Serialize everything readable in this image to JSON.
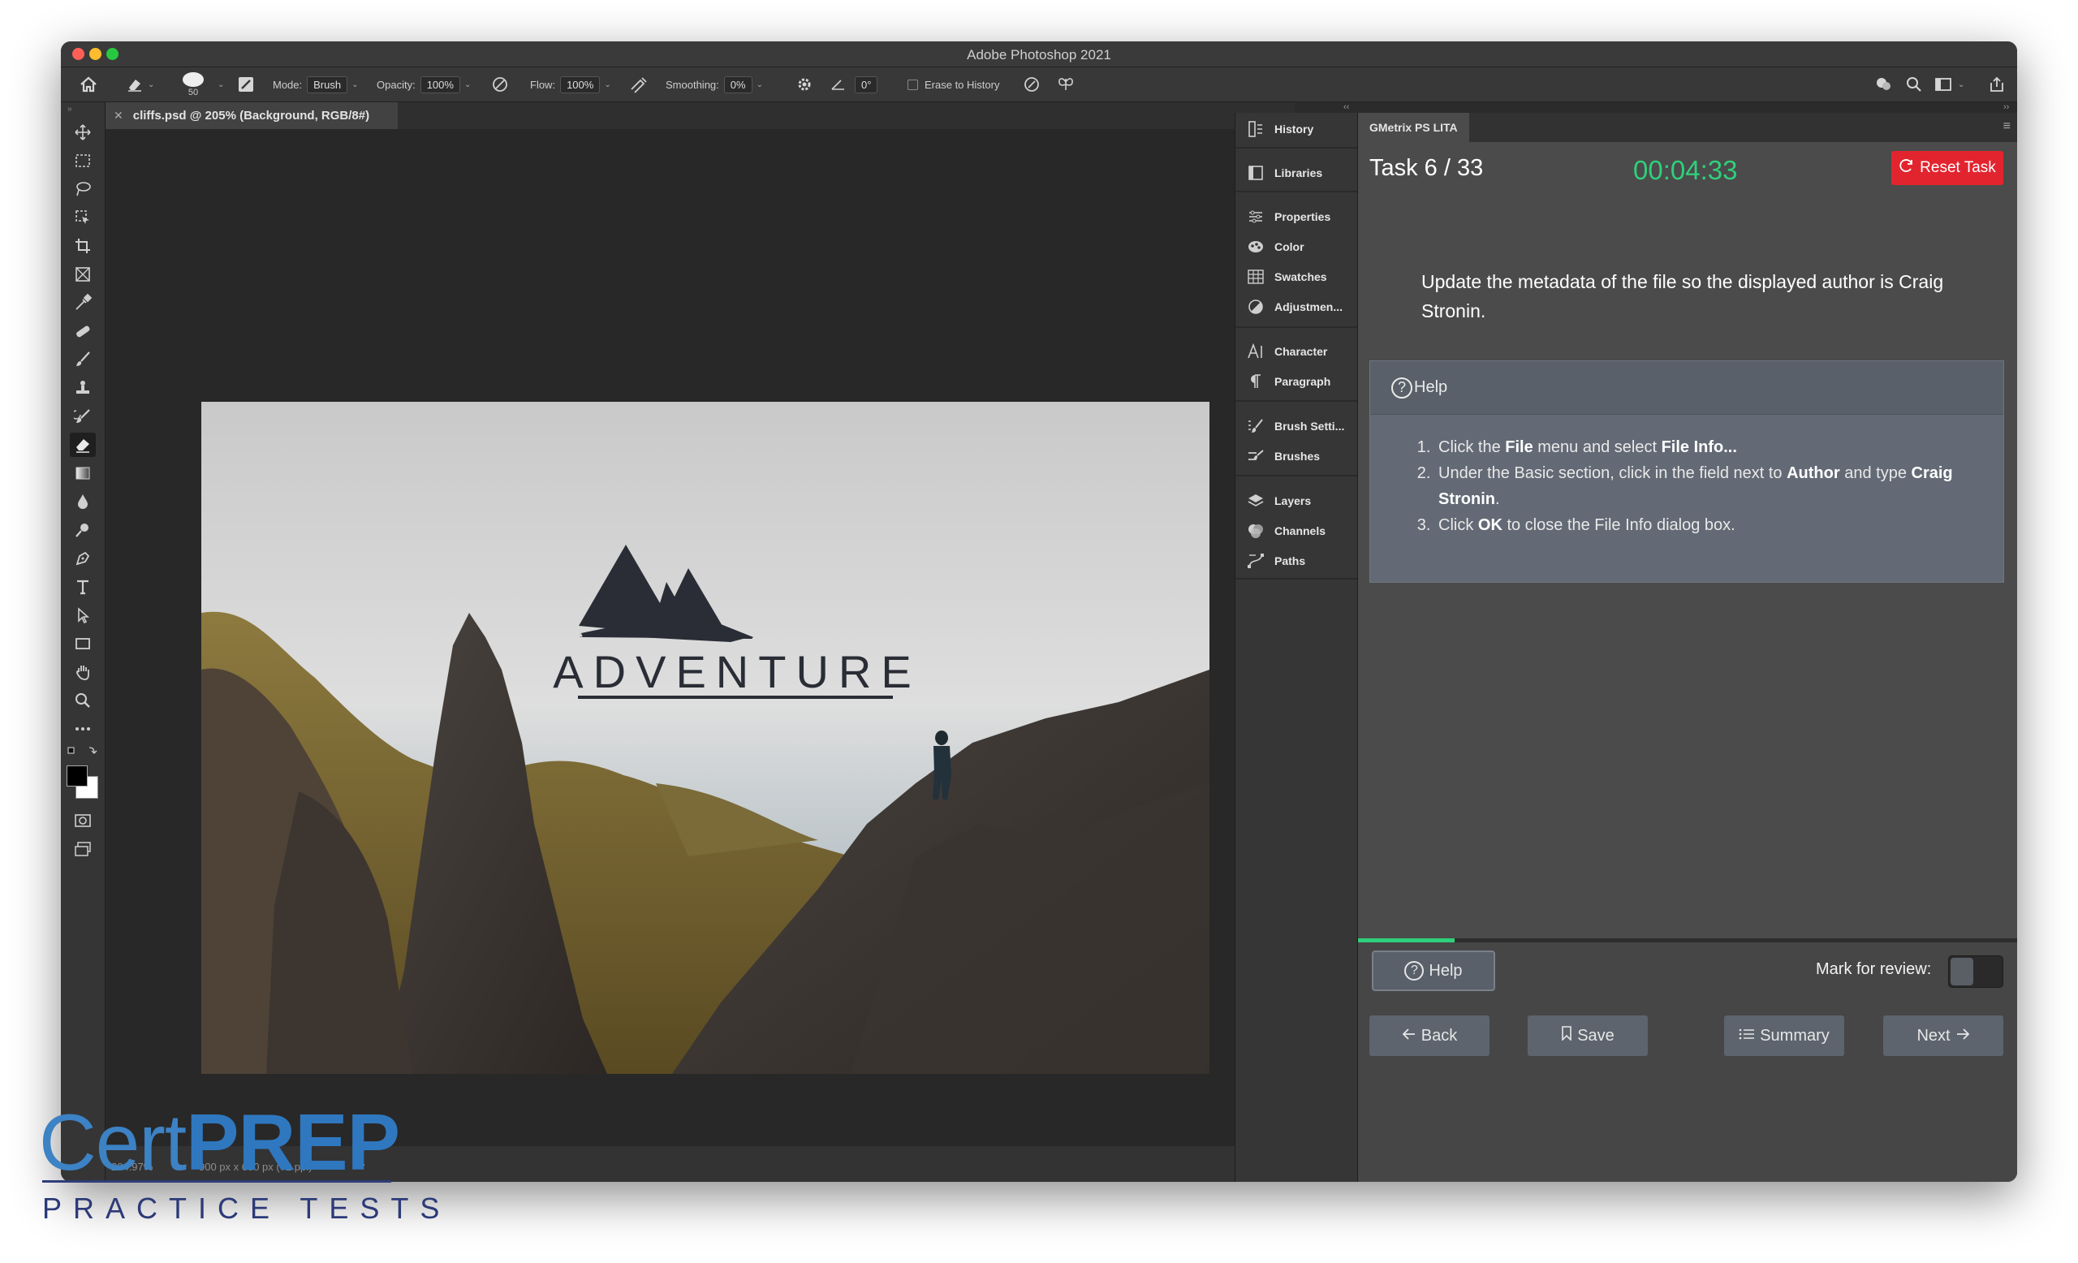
{
  "app": {
    "window_title": "Adobe Photoshop 2021"
  },
  "options_bar": {
    "brush_size": "50",
    "mode_label": "Mode:",
    "mode_value": "Brush",
    "opacity_label": "Opacity:",
    "opacity_value": "100%",
    "flow_label": "Flow:",
    "flow_value": "100%",
    "smoothing_label": "Smoothing:",
    "smoothing_value": "0%",
    "angle_value": "0°",
    "erase_history_label": "Erase to History"
  },
  "document": {
    "tab_label": "cliffs.psd @ 205% (Background, RGB/8#)",
    "status_zoom": "204.97%",
    "status_size": "900 px x 600 px (72 ppi)",
    "image_text": "ADVENTURE"
  },
  "panels": {
    "items": [
      {
        "label": "History",
        "icon": "history-icon"
      },
      {
        "label": "Libraries",
        "icon": "libraries-icon"
      },
      {
        "label": "Properties",
        "icon": "properties-icon"
      },
      {
        "label": "Color",
        "icon": "color-icon"
      },
      {
        "label": "Swatches",
        "icon": "swatches-icon"
      },
      {
        "label": "Adjustmen...",
        "icon": "adjustments-icon"
      },
      {
        "label": "Character",
        "icon": "character-icon"
      },
      {
        "label": "Paragraph",
        "icon": "paragraph-icon"
      },
      {
        "label": "Brush Setti...",
        "icon": "brush-settings-icon"
      },
      {
        "label": "Brushes",
        "icon": "brushes-icon"
      },
      {
        "label": "Layers",
        "icon": "layers-icon"
      },
      {
        "label": "Channels",
        "icon": "channels-icon"
      },
      {
        "label": "Paths",
        "icon": "paths-icon"
      }
    ]
  },
  "gmetrix": {
    "tab_label": "GMetrix PS LITA",
    "task_label": "Task 6 / 33",
    "timer": "00:04:33",
    "reset_label": "Reset Task",
    "instruction": "Update the metadata of the file so the displayed author is Craig Stronin.",
    "help_header": "Help",
    "steps": [
      {
        "a": "Click the ",
        "b": "File",
        "c": " menu and select ",
        "d": "File Info...",
        "e": "",
        "f": ""
      },
      {
        "a": "Under the Basic section, click in the field next to ",
        "b": "Author",
        "c": " and type ",
        "d": "Craig Stronin",
        "e": ".",
        "f": ""
      },
      {
        "a": "Click ",
        "b": "OK",
        "c": " to close the File Info dialog box.",
        "d": "",
        "e": "",
        "f": ""
      }
    ],
    "progress_fraction": 0.147,
    "footer": {
      "help_label": "Help",
      "mark_review_label": "Mark for review:",
      "mark_review_on": false,
      "back_label": "Back",
      "save_label": "Save",
      "summary_label": "Summary",
      "next_label": "Next"
    },
    "colors": {
      "timer": "#2fd07b",
      "reset": "#e2242f",
      "progress": "#2fd07b"
    }
  },
  "watermark": {
    "brand_light": "Cert",
    "brand_bold": "PREP",
    "tagline": "PRACTICE TESTS"
  }
}
